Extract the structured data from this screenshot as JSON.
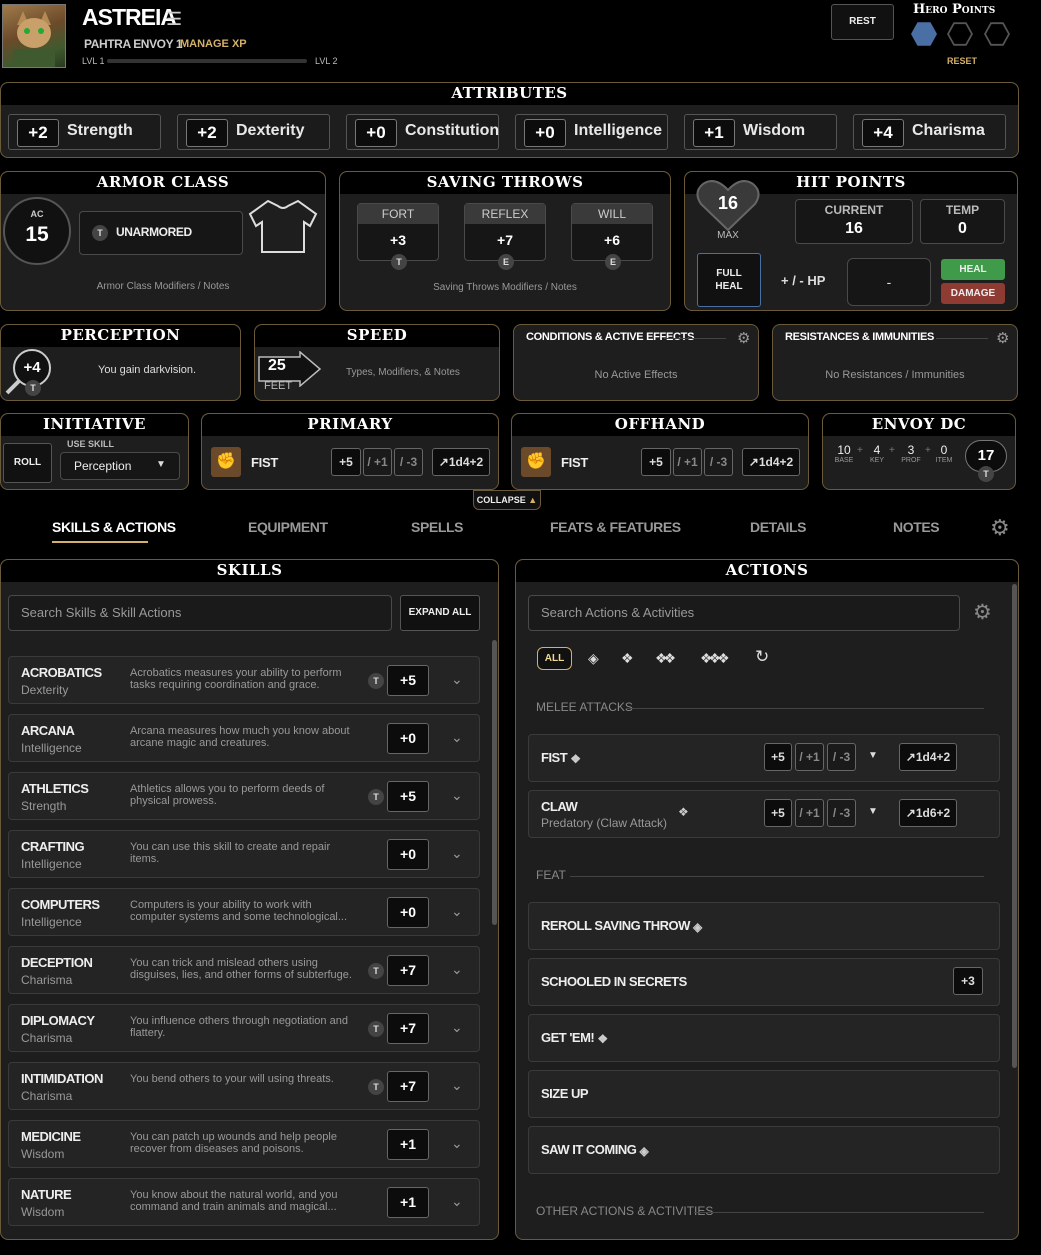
{
  "header": {
    "name": "ASTREIA",
    "subtitle": "PAHTRA ENVOY 1",
    "manage_xp": "MANAGE XP",
    "lvl_from": "LVL 1",
    "lvl_to": "LVL 2",
    "rest": "REST",
    "hero_points_label": "Hero Points",
    "reset": "RESET",
    "xp_progress": 0.0,
    "hero_points_filled": 1,
    "hero_points_total": 3
  },
  "attributes": {
    "title": "ATTRIBUTES",
    "items": [
      {
        "mod": "+2",
        "name": "Strength"
      },
      {
        "mod": "+2",
        "name": "Dexterity"
      },
      {
        "mod": "+0",
        "name": "Constitution"
      },
      {
        "mod": "+0",
        "name": "Intelligence"
      },
      {
        "mod": "+1",
        "name": "Wisdom"
      },
      {
        "mod": "+4",
        "name": "Charisma"
      }
    ]
  },
  "armor": {
    "title": "ARMOR CLASS",
    "ac_label": "AC",
    "ac": "15",
    "armor": "UNARMORED",
    "rank": "T",
    "notes": "Armor Class Modifiers / Notes"
  },
  "saves": {
    "title": "SAVING THROWS",
    "items": [
      {
        "label": "FORT",
        "value": "+3",
        "rank": "T"
      },
      {
        "label": "REFLEX",
        "value": "+7",
        "rank": "E"
      },
      {
        "label": "WILL",
        "value": "+6",
        "rank": "E"
      }
    ],
    "notes": "Saving Throws Modifiers / Notes"
  },
  "hp": {
    "title": "HIT POINTS",
    "max": "16",
    "max_label": "MAX",
    "current_label": "CURRENT",
    "current": "16",
    "temp_label": "TEMP",
    "temp": "0",
    "full_heal": "FULL HEAL",
    "plusminus": "+ / - HP",
    "input": "-",
    "heal": "HEAL",
    "damage": "DAMAGE"
  },
  "perception": {
    "title": "PERCEPTION",
    "value": "+4",
    "rank": "T",
    "note": "You gain darkvision."
  },
  "speed": {
    "title": "SPEED",
    "value": "25",
    "unit": "FEET",
    "note": "Types, Modifiers, & Notes"
  },
  "conditions": {
    "title": "CONDITIONS & ACTIVE EFFECTS",
    "empty": "No Active Effects"
  },
  "resistances": {
    "title": "RESISTANCES & IMMUNITIES",
    "empty": "No Resistances / Immunities"
  },
  "initiative": {
    "title": "INITIATIVE",
    "roll": "ROLL",
    "use_skill": "USE SKILL",
    "skill": "Perception"
  },
  "primary": {
    "title": "PRIMARY",
    "weapon": "FIST",
    "hit": "+5",
    "map2": "/ +1",
    "map3": "/ -3",
    "dmg": "1d4+2"
  },
  "offhand": {
    "title": "OFFHAND",
    "weapon": "FIST",
    "hit": "+5",
    "map2": "/ +1",
    "map3": "/ -3",
    "dmg": "1d4+2"
  },
  "envoy": {
    "title": "ENVOY DC",
    "base": "10",
    "base_l": "BASE",
    "key": "4",
    "key_l": "KEY",
    "prof": "3",
    "prof_l": "PROF",
    "item": "0",
    "item_l": "ITEM",
    "dc": "17",
    "rank": "T",
    "plus": "+"
  },
  "collapse": "COLLAPSE",
  "tabs": [
    "SKILLS & ACTIONS",
    "EQUIPMENT",
    "SPELLS",
    "FEATS & FEATURES",
    "DETAILS",
    "NOTES"
  ],
  "skills": {
    "title": "SKILLS",
    "search_placeholder": "Search Skills & Skill Actions",
    "expand_all": "EXPAND ALL",
    "items": [
      {
        "name": "ACROBATICS",
        "attr": "Dexterity",
        "desc": "Acrobatics measures your ability to perform tasks requiring coordination and grace.",
        "value": "+5",
        "rank": "T"
      },
      {
        "name": "ARCANA",
        "attr": "Intelligence",
        "desc": "Arcana measures how much you know about arcane magic and creatures.",
        "value": "+0",
        "rank": ""
      },
      {
        "name": "ATHLETICS",
        "attr": "Strength",
        "desc": "Athletics allows you to perform deeds of physical prowess.",
        "value": "+5",
        "rank": "T"
      },
      {
        "name": "CRAFTING",
        "attr": "Intelligence",
        "desc": "You can use this skill to create and repair items.",
        "value": "+0",
        "rank": ""
      },
      {
        "name": "COMPUTERS",
        "attr": "Intelligence",
        "desc": "Computers is your ability to work with computer systems and some technological...",
        "value": "+0",
        "rank": ""
      },
      {
        "name": "DECEPTION",
        "attr": "Charisma",
        "desc": "You can trick and mislead others using disguises, lies, and other forms of subterfuge.",
        "value": "+7",
        "rank": "T"
      },
      {
        "name": "DIPLOMACY",
        "attr": "Charisma",
        "desc": "You influence others through negotiation and flattery.",
        "value": "+7",
        "rank": "T"
      },
      {
        "name": "INTIMIDATION",
        "attr": "Charisma",
        "desc": "You bend others to your will using threats.",
        "value": "+7",
        "rank": "T"
      },
      {
        "name": "MEDICINE",
        "attr": "Wisdom",
        "desc": "You can patch up wounds and help people recover from diseases and poisons.",
        "value": "+1",
        "rank": ""
      },
      {
        "name": "NATURE",
        "attr": "Wisdom",
        "desc": "You know about the natural world, and you command and train animals and magical...",
        "value": "+1",
        "rank": ""
      }
    ]
  },
  "actions": {
    "title": "ACTIONS",
    "search_placeholder": "Search Actions & Activities",
    "all": "ALL",
    "melee": "MELEE ATTACKS",
    "feat": "FEAT",
    "other": "OTHER ACTIONS & ACTIVITIES",
    "attacks": [
      {
        "name": "FIST",
        "sub": "",
        "hit": "+5",
        "map2": "/ +1",
        "map3": "/ -3",
        "dmg": "1d4+2"
      },
      {
        "name": "CLAW",
        "sub": "Predatory (Claw Attack)",
        "hit": "+5",
        "map2": "/ +1",
        "map3": "/ -3",
        "dmg": "1d6+2"
      }
    ],
    "feats": [
      {
        "name": "REROLL SAVING THROW",
        "icon": "free-action",
        "bonus": ""
      },
      {
        "name": "SCHOOLED IN SECRETS",
        "icon": "",
        "bonus": "+3"
      },
      {
        "name": "GET 'EM!",
        "icon": "one-action",
        "bonus": ""
      },
      {
        "name": "SIZE UP",
        "icon": "",
        "bonus": ""
      },
      {
        "name": "SAW IT COMING",
        "icon": "free-action",
        "bonus": ""
      }
    ]
  },
  "colors": {
    "accent": "#d4b16a",
    "heal": "#3f9b4a",
    "damage": "#8e3b34",
    "hero_fill": "#4a6fa5"
  }
}
